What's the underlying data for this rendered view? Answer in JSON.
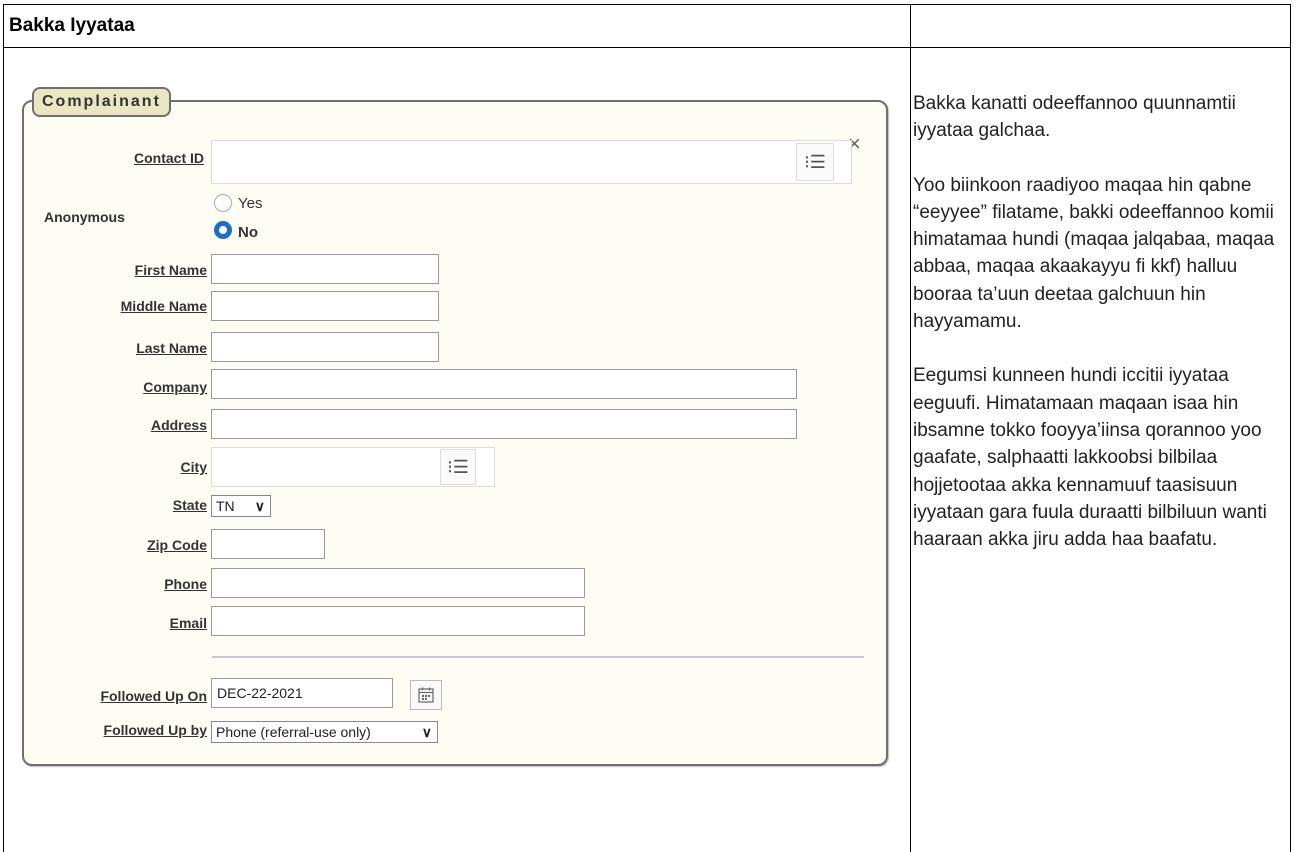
{
  "document": {
    "header_title": "Bakka Iyyataa"
  },
  "form": {
    "legend": "Complainant",
    "close_glyph": "×",
    "list_glyph": "⁝☰",
    "contact_id": {
      "label": "Contact ID",
      "value": ""
    },
    "anonymous": {
      "label": "Anonymous",
      "options": [
        "Yes",
        "No"
      ],
      "selected": "No"
    },
    "first_name": {
      "label": "First Name",
      "value": ""
    },
    "middle_name": {
      "label": "Middle Name",
      "value": ""
    },
    "last_name": {
      "label": "Last Name",
      "value": ""
    },
    "company": {
      "label": "Company",
      "value": ""
    },
    "address": {
      "label": "Address",
      "value": ""
    },
    "city": {
      "label": "City",
      "value": ""
    },
    "state": {
      "label": "State",
      "value": "TN"
    },
    "zip_code": {
      "label": "Zip Code",
      "value": ""
    },
    "phone": {
      "label": "Phone",
      "value": ""
    },
    "email": {
      "label": "Email",
      "value": ""
    },
    "followed_up_on": {
      "label": "Followed Up On",
      "value": "DEC-22-2021"
    },
    "followed_up_by": {
      "label": "Followed Up by",
      "value": "Phone (referral-use only)"
    }
  },
  "instructions": {
    "p1": "Bakka kanatti odeeffannoo quunnamtii iyyataa galchaa.",
    "p2": "Yoo biinkoon raadiyoo maqaa hin qabne “eeyyee” filatame, bakki odeeffannoo komii himatamaa hundi (maqaa jalqabaa, maqaa abbaa, maqaa akaakayyu fi kkf) halluu booraa ta’uun deetaa galchuun hin hayyamamu.",
    "p3": "Eegumsi kunneen hundi iccitii iyyataa eeguufi. Himatamaan maqaan isaa hin ibsamne tokko fooyya’iinsa qorannoo yoo gaafate, salphaatti lakkoobsi bilbilaa hojjetootaa akka kennamuuf taasisuun iyyataan gara fuula duraatti bilbiluun wanti haaraan akka jiru adda haa baafatu."
  }
}
